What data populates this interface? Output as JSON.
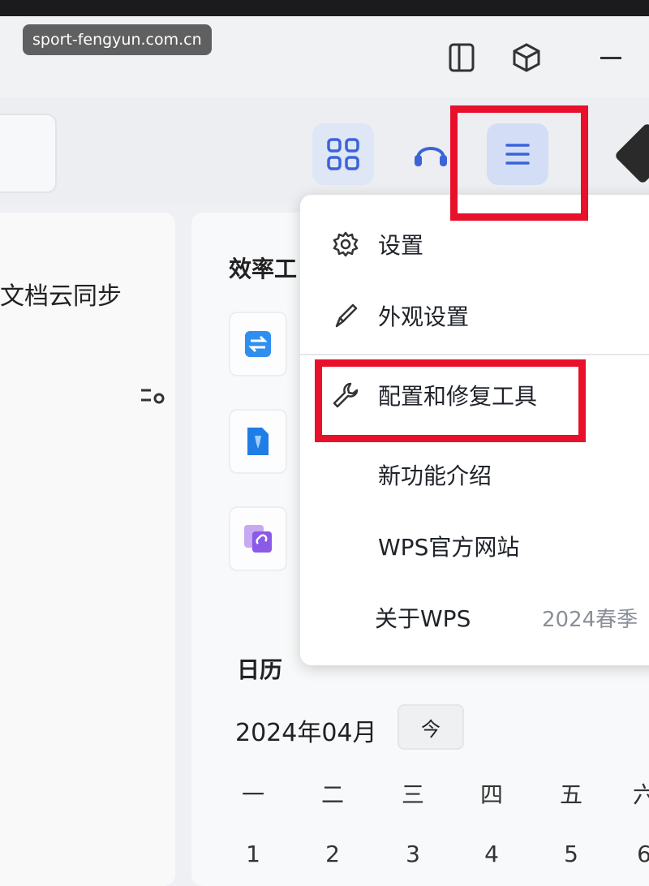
{
  "watermark": "sport-fengyun.com.cn",
  "left_panel": {
    "title": "文档云同步"
  },
  "main": {
    "efficiency_title": "效率工",
    "calendar_title": "日历",
    "month": "2024年04月",
    "today_label": "今",
    "weekdays": [
      "一",
      "二",
      "三",
      "四",
      "五",
      "六"
    ],
    "days": [
      "1",
      "2",
      "3",
      "4",
      "5",
      "6"
    ]
  },
  "menu": {
    "items": [
      {
        "label": "设置",
        "icon": "gear-icon"
      },
      {
        "label": "外观设置",
        "icon": "brush-icon"
      },
      {
        "label": "配置和修复工具",
        "icon": "wrench-icon"
      },
      {
        "label": "新功能介绍"
      },
      {
        "label": "WPS官方网站"
      },
      {
        "label": "关于WPS",
        "version": "2024春季"
      }
    ]
  },
  "colors": {
    "highlight": "#e8102b",
    "accent": "#3b64d8"
  }
}
